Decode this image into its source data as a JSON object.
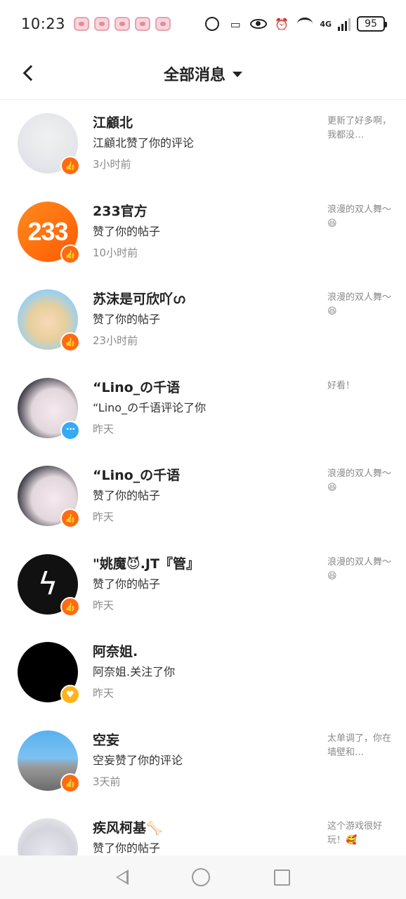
{
  "status_bar": {
    "time": "10:23",
    "battery": "95",
    "network": "4G"
  },
  "header": {
    "title": "全部消息"
  },
  "messages": [
    {
      "name": "江顧北",
      "action": "江顧北赞了你的评论",
      "time": "3小时前",
      "preview": "更新了好多啊，我都没…",
      "badge": "like",
      "avatar": "anime1"
    },
    {
      "name": "233官方",
      "action": "赞了你的帖子",
      "time": "10小时前",
      "preview": "浪漫的双人舞～😆",
      "badge": "like",
      "avatar": "233",
      "avatar_text": "233"
    },
    {
      "name": "苏沫是可欣吖ഗ",
      "action": "赞了你的帖子",
      "time": "23小时前",
      "preview": "浪漫的双人舞～😆",
      "badge": "like",
      "avatar": "anime2"
    },
    {
      "name": "“Lino_の千语",
      "action": "“Lino_の千语评论了你",
      "time": "昨天",
      "preview": "好看！",
      "badge": "comment",
      "avatar": "anime3"
    },
    {
      "name": "“Lino_の千语",
      "action": "赞了你的帖子",
      "time": "昨天",
      "preview": "浪漫的双人舞～😆",
      "badge": "like",
      "avatar": "anime3"
    },
    {
      "name": "\"姚魔😈.JT『管』",
      "action": "赞了你的帖子",
      "time": "昨天",
      "preview": "浪漫的双人舞～😆",
      "badge": "like",
      "avatar": "bolt"
    },
    {
      "name": "阿奈姐.",
      "action": "阿奈姐.关注了你",
      "time": "昨天",
      "preview": "",
      "badge": "follow",
      "avatar": "black"
    },
    {
      "name": "空妄",
      "action": "空妄赞了你的评论",
      "time": "3天前",
      "preview": "太单调了，你在墙壁和…",
      "badge": "like",
      "avatar": "scene"
    },
    {
      "name": "疾风柯基🦴",
      "action": "赞了你的帖子",
      "time": "",
      "preview": "这个游戏很好玩！🥰",
      "badge": "like",
      "avatar": "purple"
    }
  ],
  "icons": {
    "like": "thumbs-up-icon",
    "comment": "chat-bubble-icon",
    "follow": "heart-icon"
  },
  "colors": {
    "like_badge": "#ff6a13",
    "comment_badge": "#36aaf3",
    "follow_badge": "#ffb21a"
  }
}
